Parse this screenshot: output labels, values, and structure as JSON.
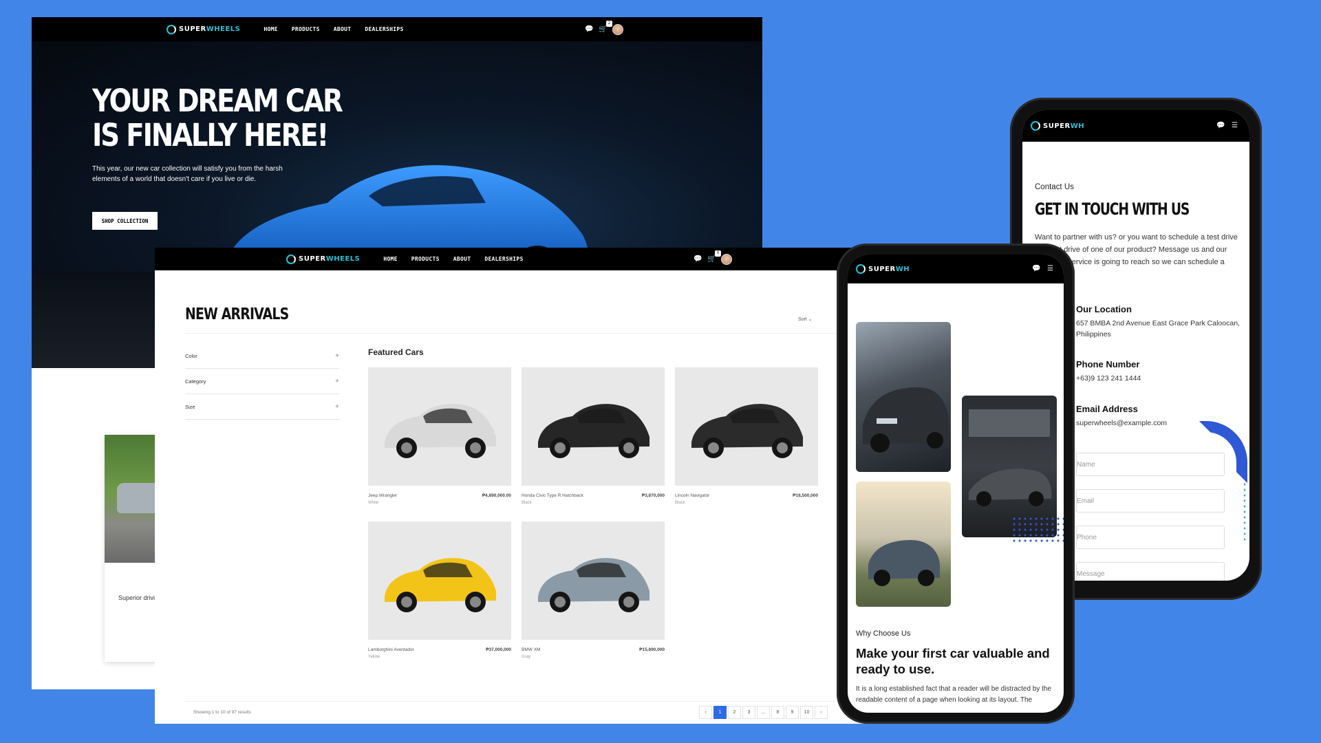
{
  "brand": {
    "word1": "SUPER",
    "word2": "WHEELS",
    "short_word2": "WH"
  },
  "nav": {
    "links": [
      "HOME",
      "PRODUCTS",
      "ABOUT",
      "DEALERSHIPS"
    ],
    "cart_count_hero": "2",
    "cart_count_products": "0"
  },
  "hero": {
    "title_line1": "YOUR DREAM CAR",
    "title_line2": "IS FINALLY HERE!",
    "description": "This year, our new car collection will satisfy you from the harsh elements of a world that doesn't care if you live or die.",
    "button": "SHOP COLLECTION",
    "promo_text": "Superior drivi"
  },
  "products": {
    "title": "NEW ARRIVALS",
    "sort_label": "Sort",
    "filters": [
      "Color",
      "Category",
      "Size"
    ],
    "featured_label": "Featured Cars",
    "items": [
      {
        "name": "Jeep Wrangler",
        "price": "₱4,890,000.00",
        "color": "White",
        "body_color": "#d9d9d9"
      },
      {
        "name": "Honda Civic Type R Hatchback",
        "price": "₱3,870,000",
        "color": "Black",
        "body_color": "#262626"
      },
      {
        "name": "Lincoln Navigator",
        "price": "₱18,500,000",
        "color": "Black",
        "body_color": "#2b2b2b"
      },
      {
        "name": "Lamborghini Aventador",
        "price": "₱37,000,000",
        "color": "Yellow",
        "body_color": "#f2c418"
      },
      {
        "name": "BMW XM",
        "price": "₱15,890,000",
        "color": "Gray",
        "body_color": "#8a9aa6"
      }
    ],
    "showing": "Showing 1 to 10 of 97 results",
    "pages": [
      "‹",
      "1",
      "2",
      "3",
      "...",
      "8",
      "9",
      "10",
      "›"
    ],
    "active_page": "1"
  },
  "contact": {
    "subtitle": "Contact Us",
    "title": "GET IN TOUCH WITH US",
    "description": "Want to partner with us? or you want to schedule a test drive and test drive of one of our product? Message us and our customer service is going to reach so we can schedule a meeting.",
    "location_label": "Our Location",
    "location_value": "657 BMBA 2nd Avenue East Grace Park Caloocan, Philippines",
    "phone_label": "Phone Number",
    "phone_value": "+63)9 123 241 1444",
    "email_label": "Email Address",
    "email_value": "superwheels@example.com",
    "placeholders": {
      "name": "Name",
      "email": "Email",
      "phone": "Phone",
      "message": "Message"
    }
  },
  "why": {
    "subtitle": "Why Choose Us",
    "title": "Make your first car valuable and ready to use.",
    "description": "It is a long established fact that a reader will be distracted by the readable content of a page when looking at its layout. The"
  },
  "colors": {
    "background": "#4285e8",
    "accent": "#2e6be6",
    "brand_teal": "#29c0d8",
    "hero_car": "#1f6fd6"
  }
}
